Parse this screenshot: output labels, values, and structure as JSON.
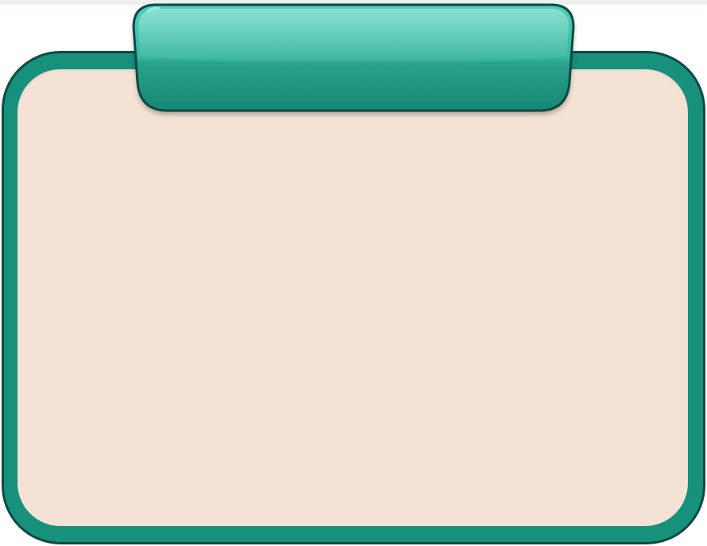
{
  "header": {
    "title": ""
  },
  "panel": {
    "body_text": ""
  },
  "colors": {
    "frame_teal": "#17907c",
    "frame_outline": "#0e4a42",
    "tab_top": "#4ccdb8",
    "tab_bottom": "#178a77",
    "content_background": "#f4e3d5",
    "page_background": "#ffffff"
  }
}
